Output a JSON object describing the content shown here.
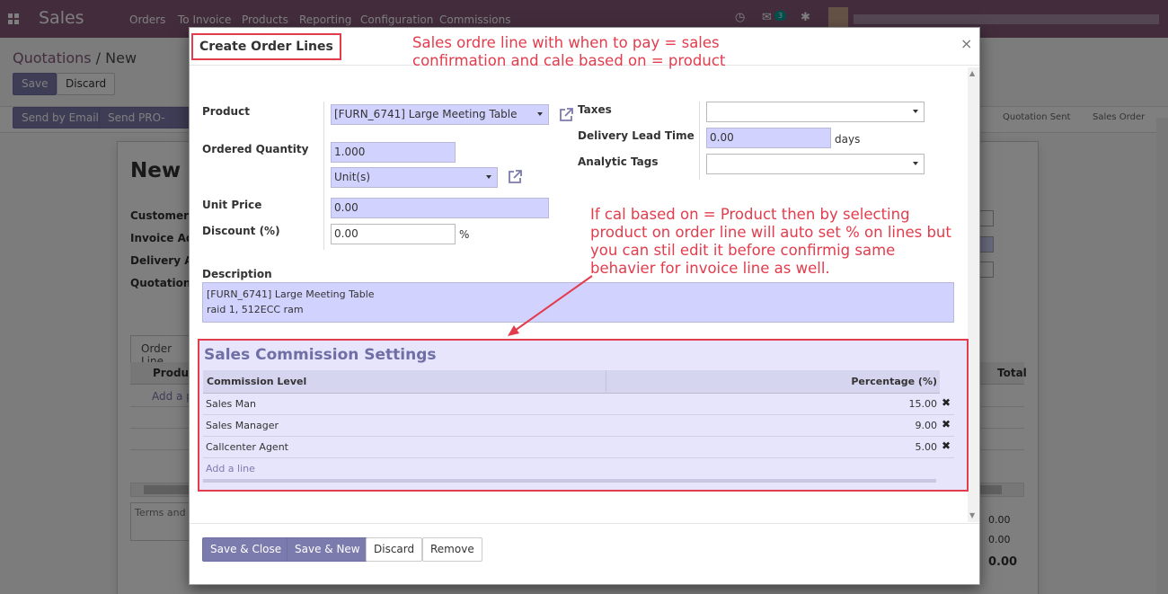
{
  "app": {
    "name": "Sales"
  },
  "nav": {
    "menu": [
      "Orders",
      "To Invoice",
      "Products",
      "Reporting",
      "Configuration",
      "Commissions"
    ],
    "messages_badge": "3"
  },
  "breadcrumb": {
    "parent": "Quotations",
    "sep": " / ",
    "current": "New"
  },
  "controls": {
    "save": "Save",
    "discard": "Discard"
  },
  "actions": {
    "send_email": "Send by Email",
    "send_proforma": "Send PRO-FORM"
  },
  "statusbar": {
    "steps": [
      "Quotation Sent",
      "Sales Order"
    ]
  },
  "background_form": {
    "title": "New",
    "labels": [
      "Customer",
      "Invoice Add",
      "Delivery Ad",
      "Quotation T"
    ],
    "tab": "Order Line",
    "col_product": "Produc",
    "col_total": "Total",
    "add_product": "Add a p",
    "terms": "Terms and c",
    "totals": [
      "0.00",
      "0.00",
      "0.00"
    ]
  },
  "modal": {
    "title": "Create Order Lines",
    "close": "×",
    "fields": {
      "product_label": "Product",
      "product_value": "[FURN_6741] Large Meeting Table",
      "qty_label": "Ordered Quantity",
      "qty_value": "1.000",
      "uom_value": "Unit(s)",
      "price_label": "Unit Price",
      "price_value": "0.00",
      "discount_label": "Discount (%)",
      "discount_value": "0.00",
      "discount_unit": "%",
      "taxes_label": "Taxes",
      "lead_label": "Delivery Lead Time",
      "lead_value": "0.00",
      "lead_unit": "days",
      "tags_label": "Analytic Tags",
      "description_label": "Description",
      "description_line1": "[FURN_6741] Large Meeting Table",
      "description_line2": "raid 1, 512ECC ram"
    },
    "commission": {
      "title": "Sales Commission Settings",
      "col_level": "Commission Level",
      "col_pct": "Percentage (%)",
      "rows": [
        {
          "level": "Sales Man",
          "pct": "15.00"
        },
        {
          "level": "Sales Manager",
          "pct": "9.00"
        },
        {
          "level": "Callcenter Agent",
          "pct": "5.00"
        }
      ],
      "add_line": "Add a line"
    },
    "footer": {
      "save_close": "Save & Close",
      "save_new": "Save & New",
      "discard": "Discard",
      "remove": "Remove"
    }
  },
  "annotations": {
    "top_line1": "Sales ordre line with when to pay = sales",
    "top_line2": "confirmation and cale based on = product",
    "mid_line1": "If cal based on = Product then by selecting",
    "mid_line2": "product on order line will auto set % on lines but",
    "mid_line3": "you can stil edit it before confirmig same",
    "mid_line4": "behavier for invoice line as well."
  },
  "colors": {
    "navbar": "#875a7b",
    "primary": "#7c7bad",
    "annotation": "#e33c4d",
    "input_highlight": "#d2d2ff"
  }
}
